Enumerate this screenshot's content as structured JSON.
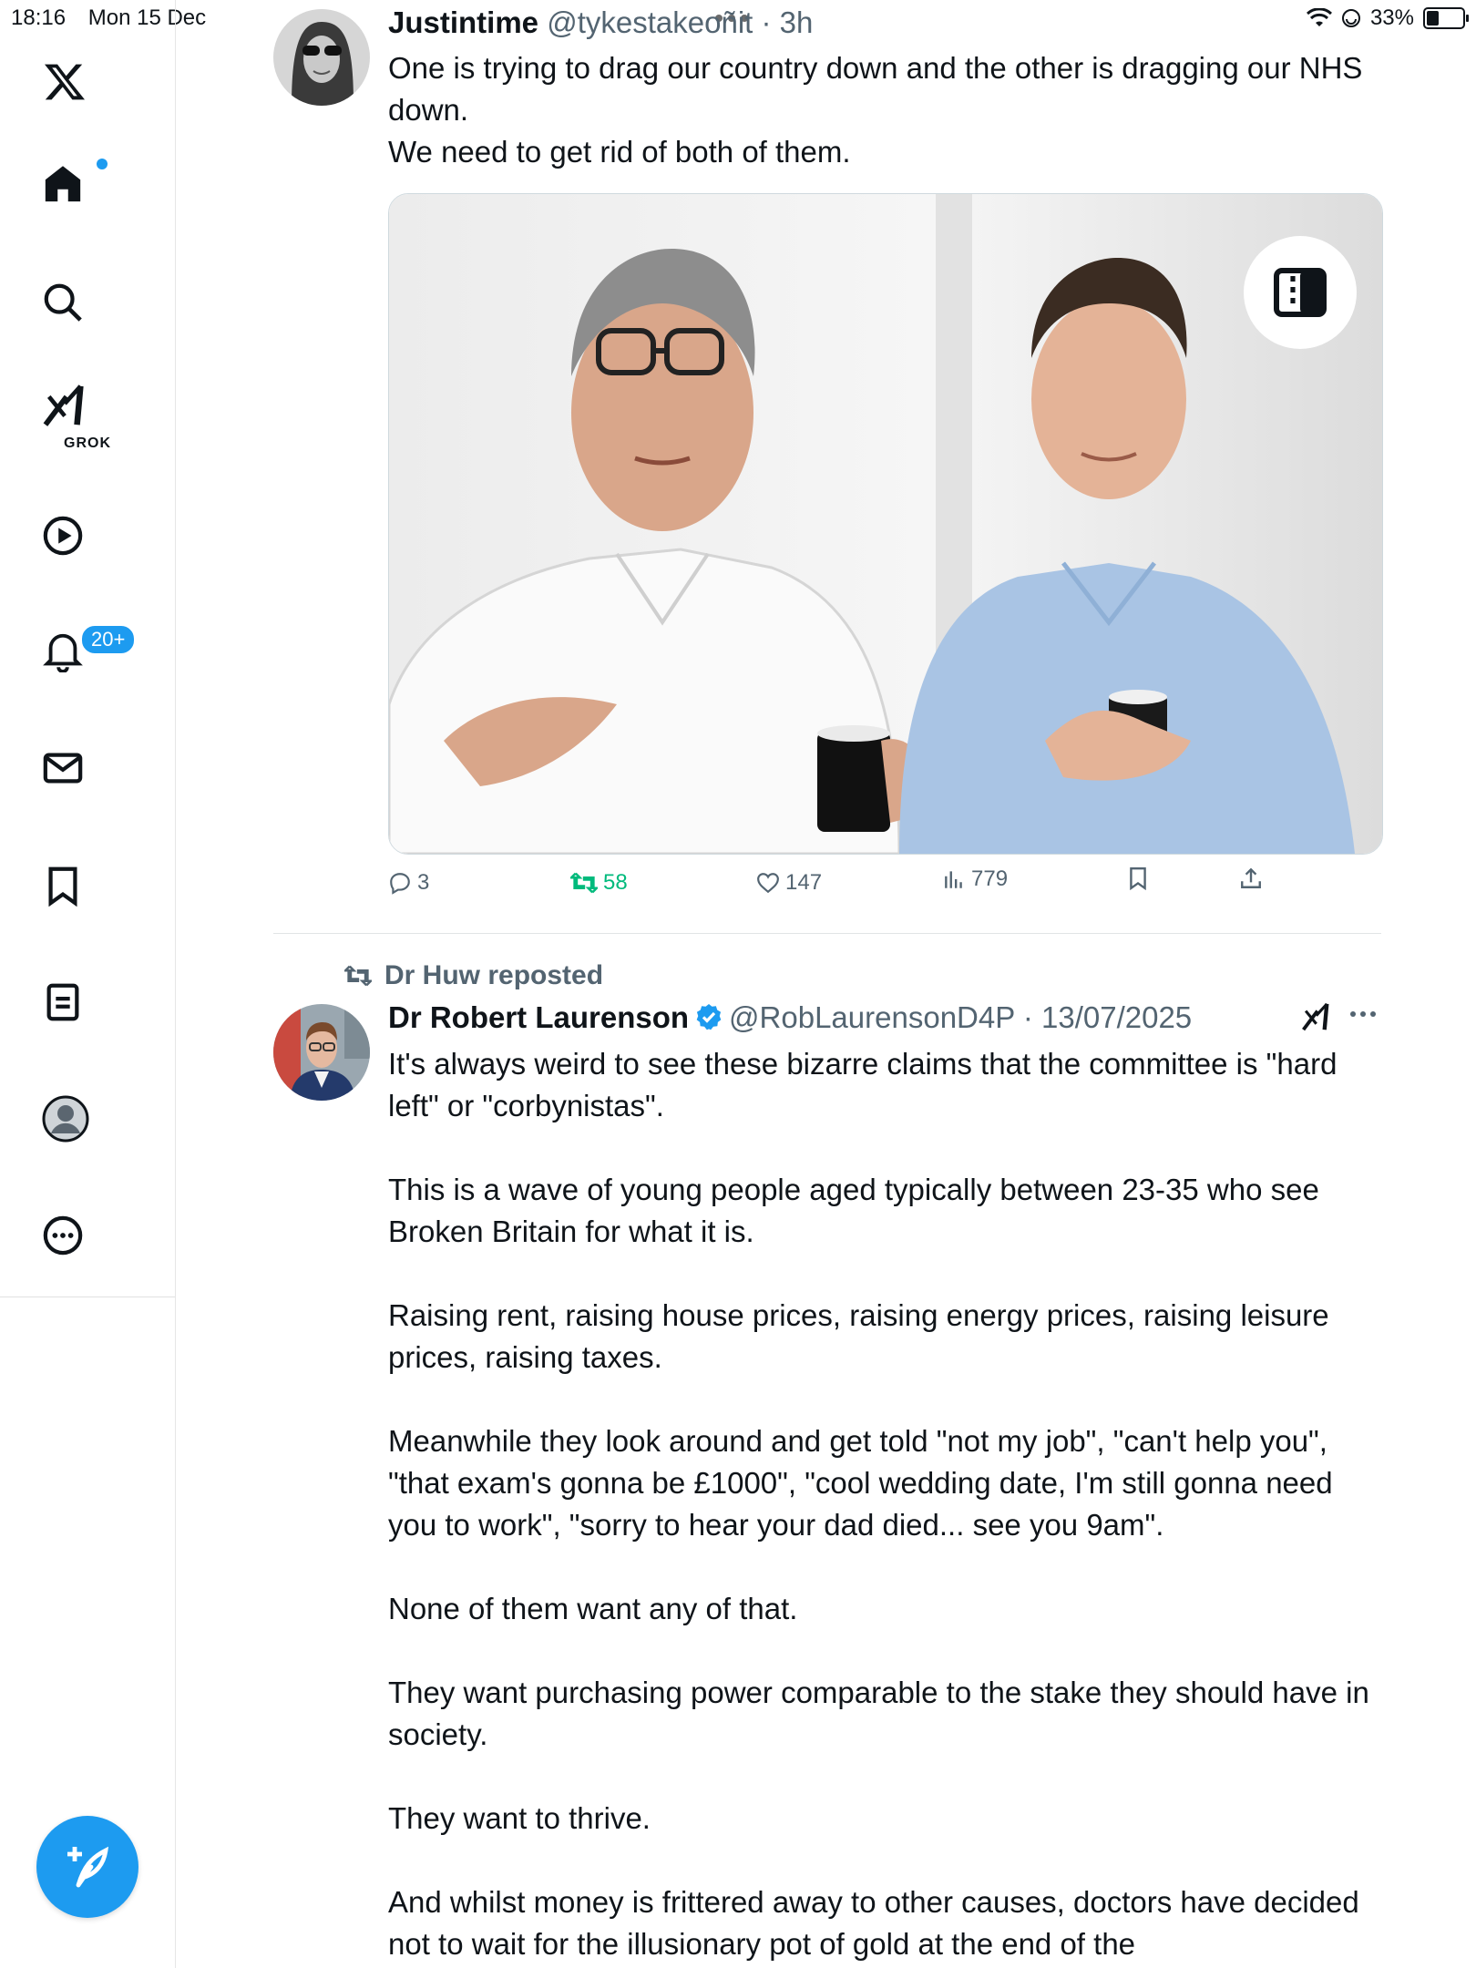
{
  "status_bar": {
    "time": "18:16",
    "date": "Mon 15 Dec",
    "battery": "33%",
    "battery_level": 0.33
  },
  "sidebar": {
    "items": [
      {
        "name": "x-logo"
      },
      {
        "name": "home",
        "has_dot": true
      },
      {
        "name": "search"
      },
      {
        "name": "grok",
        "label": "GROK"
      },
      {
        "name": "video"
      },
      {
        "name": "notifications",
        "badge": "20+"
      },
      {
        "name": "messages"
      },
      {
        "name": "bookmarks"
      },
      {
        "name": "lists"
      },
      {
        "name": "profile"
      },
      {
        "name": "more"
      }
    ]
  },
  "tweet1": {
    "display_name": "Justintime",
    "handle": "@tykestakeoñit",
    "time": "· 3h",
    "text": "One is trying to drag our country down and the other is dragging our NHS down.\nWe need to get rid of both of them.",
    "stats": {
      "replies": "3",
      "reposts": "58",
      "likes": "147",
      "views": "779"
    }
  },
  "tweet2": {
    "repost_label": "Dr Huw reposted",
    "display_name": "Dr Robert Laurenson",
    "handle": "@RobLaurensonD4P",
    "time": "· 13/07/2025",
    "text": "It's always weird to see these bizarre claims that the committee is \"hard left\" or \"corbynistas\".\n\nThis is a wave of young people aged typically between 23-35 who see Broken Britain for what it is.\n\nRaising rent, raising house prices, raising energy prices, raising leisure prices, raising taxes.\n\nMeanwhile they look around and get told \"not my job\", \"can't help you\", \"that exam's gonna be £1000\", \"cool wedding date, I'm still gonna need you to work\", \"sorry to hear your dad died... see you 9am\".\n\nNone of them want any of that.\n\nThey want purchasing power comparable to the stake they should have in society.\n\nThey want to thrive.\n\nAnd whilst money is frittered away to other causes, doctors have decided not to wait for the illusionary pot of gold at the end of the"
  },
  "colors": {
    "accent": "#1d9bf0",
    "repost_green": "#00ba7c",
    "muted_text": "#536471"
  }
}
